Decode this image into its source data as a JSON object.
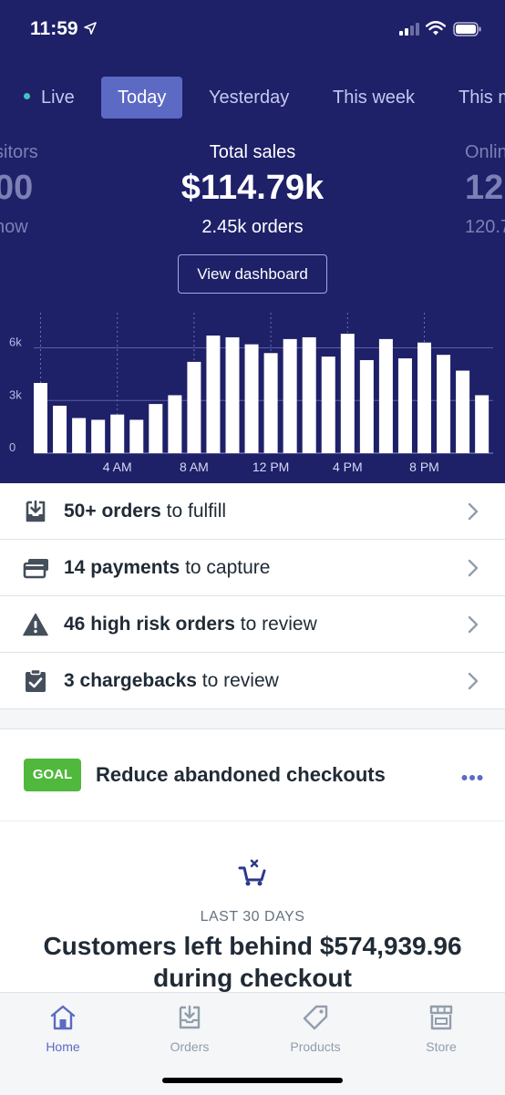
{
  "status_bar": {
    "time": "11:59"
  },
  "tabs": [
    {
      "label": "Live"
    },
    {
      "label": "Today",
      "active": true
    },
    {
      "label": "Yesterday"
    },
    {
      "label": "This week"
    },
    {
      "label": "This m"
    }
  ],
  "stats": {
    "left": {
      "label": "sitors",
      "value": "00",
      "sub": "now"
    },
    "center": {
      "label": "Total sales",
      "value": "$114.79k",
      "sub": "2.45k orders"
    },
    "right": {
      "label": "Onlin",
      "value": "12(",
      "sub": "120.7"
    }
  },
  "dashboard_button": "View dashboard",
  "chart_data": {
    "type": "bar",
    "x_tick_labels": [
      "4 AM",
      "8 AM",
      "12 PM",
      "4 PM",
      "8 PM"
    ],
    "y_tick_labels": [
      "0",
      "3k",
      "6k"
    ],
    "ylim": [
      0,
      8000
    ],
    "values": [
      4000,
      2700,
      2000,
      1900,
      2200,
      1900,
      2800,
      3300,
      5200,
      6700,
      6600,
      6200,
      5700,
      6500,
      6600,
      5500,
      6800,
      5300,
      6500,
      5400,
      6300,
      5600,
      4700,
      3300
    ],
    "grid": true
  },
  "tasks": [
    {
      "icon": "fulfill-icon",
      "bold": "50+ orders",
      "rest": " to fulfill"
    },
    {
      "icon": "payment-icon",
      "bold": "14 payments",
      "rest": " to capture"
    },
    {
      "icon": "warning-icon",
      "bold": "46 high risk orders",
      "rest": " to review"
    },
    {
      "icon": "chargeback-icon",
      "bold": "3 chargebacks",
      "rest": " to review"
    }
  ],
  "goal": {
    "badge": "GOAL",
    "title": "Reduce abandoned checkouts",
    "period": "LAST 30 DAYS",
    "headline": "Customers left behind $574,939.96 during checkout"
  },
  "nav": [
    {
      "label": "Home",
      "active": true
    },
    {
      "label": "Orders"
    },
    {
      "label": "Products"
    },
    {
      "label": "Store"
    }
  ],
  "colors": {
    "header_bg": "#1e2068",
    "accent": "#5c6ac4",
    "goal_badge": "#50b83c"
  }
}
